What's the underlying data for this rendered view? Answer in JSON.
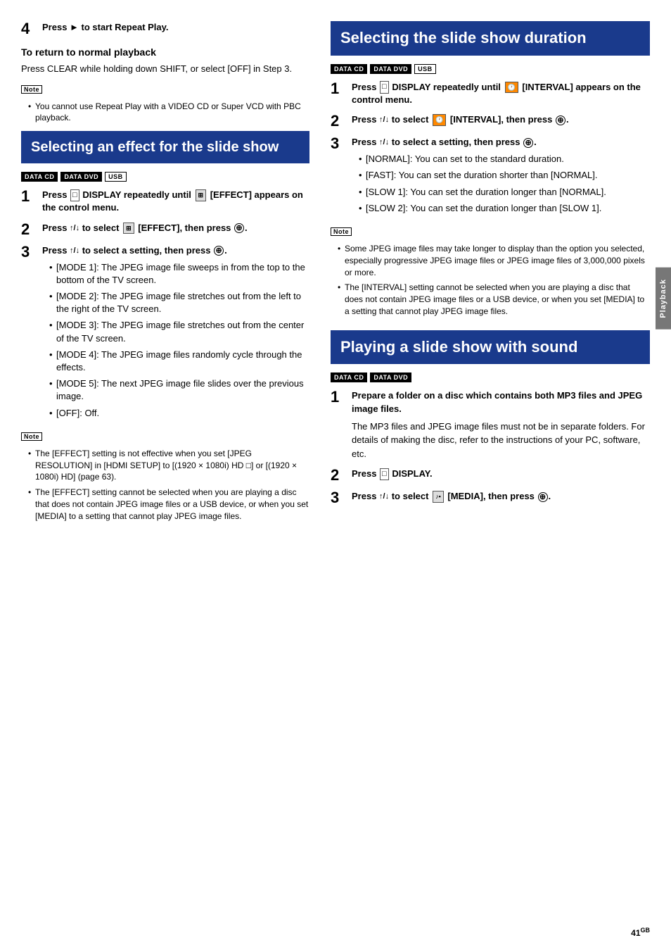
{
  "left": {
    "step4": {
      "label": "4",
      "text": "Press ► to start Repeat Play."
    },
    "to_return": {
      "title": "To return to normal playback",
      "body": "Press CLEAR while holding down SHIFT, or select [OFF] in Step 3."
    },
    "note1": {
      "label": "Note",
      "items": [
        "You cannot use Repeat Play with a VIDEO CD or Super VCD with PBC playback."
      ]
    },
    "select_effect": {
      "title": "Selecting an effect for the slide show",
      "badges": [
        "DATA CD",
        "DATA DVD",
        "USB"
      ],
      "steps": [
        {
          "num": "1",
          "html_key": "step1_effect",
          "text": "Press  DISPLAY repeatedly until  [EFFECT] appears on the control menu."
        },
        {
          "num": "2",
          "html_key": "step2_effect",
          "text": "Press ↑/↓ to select  [EFFECT], then press ⊕."
        },
        {
          "num": "3",
          "html_key": "step3_effect",
          "text": "Press ↑/↓ to select a setting, then press ⊕.",
          "bullets": [
            "[MODE 1]: The JPEG image file sweeps in from the top to the bottom of the TV screen.",
            "[MODE 2]: The JPEG image file stretches out from the left to the right of the TV screen.",
            "[MODE 3]: The JPEG image file stretches out from the center of the TV screen.",
            "[MODE 4]: The JPEG image files randomly cycle through the effects.",
            "[MODE 5]: The next JPEG image file slides over the previous image.",
            "[OFF]: Off."
          ]
        }
      ],
      "note": {
        "label": "Note",
        "items": [
          "The [EFFECT] setting is not effective when you set [JPEG RESOLUTION] in [HDMI SETUP] to [(1920 × 1080i) HD □] or [(1920 × 1080i) HD] (page 63).",
          "The [EFFECT] setting cannot be selected when you are playing a disc that does not contain JPEG image files or a USB device, or when you set [MEDIA] to a setting that cannot play JPEG image files."
        ]
      }
    }
  },
  "right": {
    "select_duration": {
      "title": "Selecting the slide show duration",
      "badges": [
        "DATA CD",
        "DATA DVD",
        "USB"
      ],
      "steps": [
        {
          "num": "1",
          "text": "Press  DISPLAY repeatedly until  [INTERVAL] appears on the control menu."
        },
        {
          "num": "2",
          "text": "Press ↑/↓ to select  [INTERVAL], then press ⊕."
        },
        {
          "num": "3",
          "text": "Press ↑/↓ to select a setting, then press ⊕.",
          "bullets": [
            "[NORMAL]: You can set to the standard duration.",
            "[FAST]: You can set the duration shorter than [NORMAL].",
            "[SLOW 1]: You can set the duration longer than [NORMAL].",
            "[SLOW 2]: You can set the duration longer than [SLOW 1]."
          ]
        }
      ],
      "note": {
        "label": "Note",
        "items": [
          "Some JPEG image files may take longer to display than the option you selected, especially progressive JPEG image files or JPEG image files of 3,000,000 pixels or more.",
          "The [INTERVAL] setting cannot be selected when you are playing a disc that does not contain JPEG image files or a USB device, or when you set [MEDIA] to a setting that cannot play JPEG image files."
        ]
      }
    },
    "playing_slideshow": {
      "title": "Playing a slide show with sound",
      "badges": [
        "DATA CD",
        "DATA DVD"
      ],
      "steps": [
        {
          "num": "1",
          "text": "Prepare a folder on a disc which contains both MP3 files and JPEG image files.",
          "body": "The MP3 files and JPEG image files must not be in separate folders. For details of making the disc, refer to the instructions of your PC, software, etc."
        },
        {
          "num": "2",
          "text": "Press  DISPLAY."
        },
        {
          "num": "3",
          "text": "Press ↑/↓ to select  [MEDIA], then press ⊕."
        }
      ]
    }
  },
  "page_number": "41",
  "page_suffix": "GB",
  "playback_label": "Playback",
  "icons": {
    "display": "□",
    "effect": "⊞",
    "interval": "🕐",
    "media": "♪▪",
    "circle_plus": "⊕",
    "arrow_updown": "↑/↓"
  }
}
